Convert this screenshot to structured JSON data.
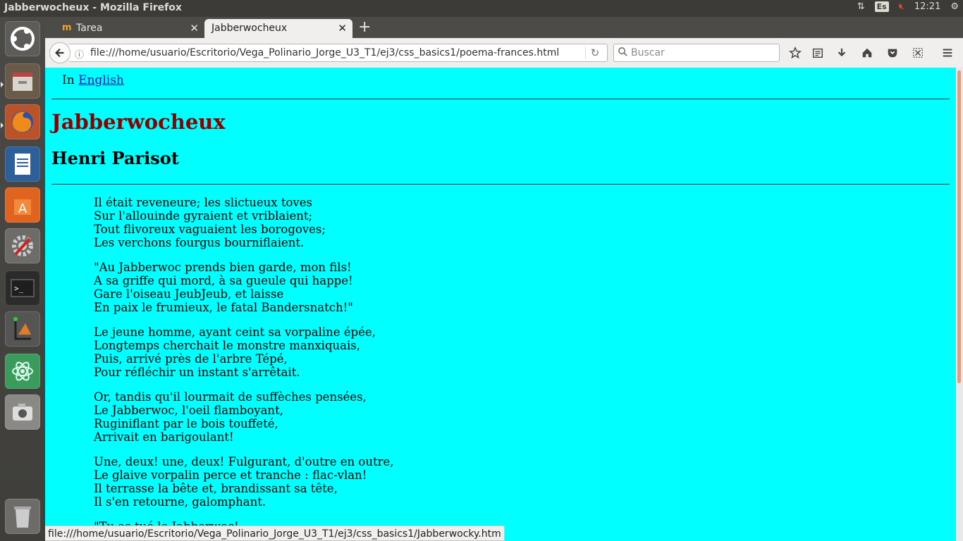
{
  "window": {
    "title": "Jabberwocheux - Mozilla Firefox"
  },
  "panel": {
    "keyboard": "Es",
    "time": "12:21"
  },
  "tabs": [
    {
      "label": "Tarea"
    },
    {
      "label": "Jabberwocheux"
    }
  ],
  "navbar": {
    "url": "file:///home/usuario/Escritorio/Vega_Polinario_Jorge_U3_T1/ej3/css_basics1/poema-frances.html",
    "search_placeholder": "Buscar"
  },
  "page": {
    "lang_prefix": "In",
    "lang_link": "English",
    "title": "Jabberwocheux",
    "author": "Henri Parisot",
    "stanzas": [
      [
        "Il était reveneure; les slictueux toves",
        "Sur l'allouinde gyraient et vriblaient;",
        "Tout flivoreux vaguaient les borogoves;",
        "Les verchons fourgus bourniflaient."
      ],
      [
        "\"Au Jabberwoc prends bien garde, mon fils!",
        "A sa griffe qui mord, à sa gueule qui happe!",
        "Gare l'oiseau JeubJeub, et laisse",
        "En paix le frumieux, le fatal Bandersnatch!\""
      ],
      [
        "Le jeune homme, ayant ceint sa vorpaline épée,",
        "Longtemps cherchait le monstre manxiquais,",
        "Puis, arrivé près de l'arbre Tépé,",
        "Pour réfléchir un instant s'arrêtait."
      ],
      [
        "Or, tandis qu'il lourmait de suffèches pensées,",
        "Le Jabberwoc, l'oeil flamboyant,",
        "Ruginiflant par le bois touffeté,",
        "Arrivait en barigoulant!"
      ],
      [
        "Une, deux! une, deux! Fulgurant, d'outre en outre,",
        "Le glaive vorpalin perce et tranche : flac-vlan!",
        "Il terrasse la bête et, brandissant sa tête,",
        "Il s'en retourne, galomphant."
      ],
      [
        "\"Tu as tué le Jabberwoc!"
      ]
    ]
  },
  "statusbar": {
    "text": "file:///home/usuario/Escritorio/Vega_Polinario_Jorge_U3_T1/ej3/css_basics1/Jabberwocky.htm"
  },
  "colors": {
    "page_bg": "#00ffff",
    "title": "#8b0000",
    "link": "#2a18b8"
  }
}
